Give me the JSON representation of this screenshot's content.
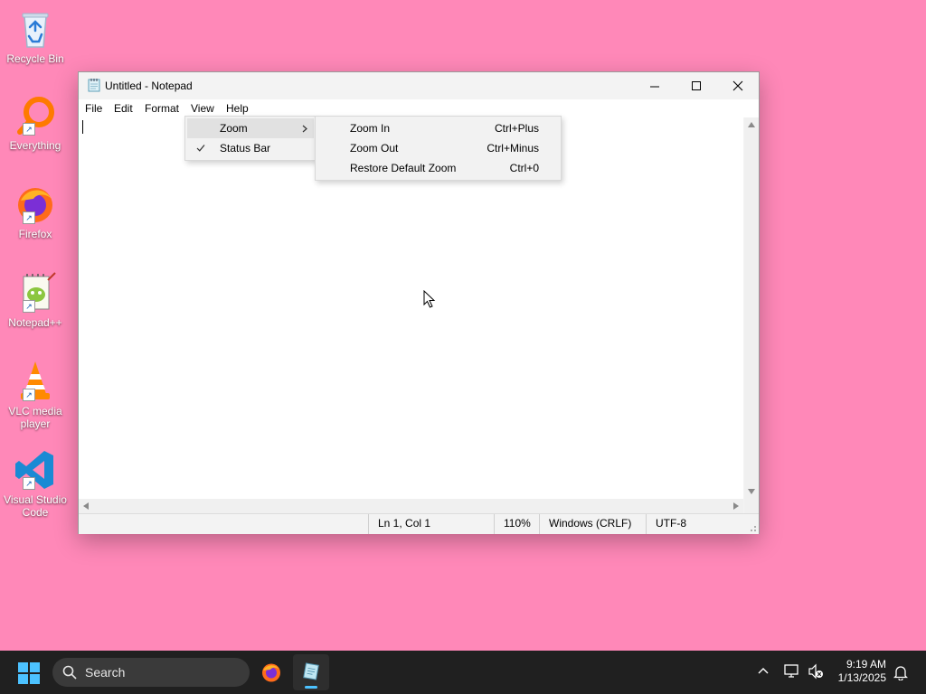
{
  "desktop": {
    "icons": [
      {
        "label": "Recycle Bin"
      },
      {
        "label": "Everything"
      },
      {
        "label": "Firefox"
      },
      {
        "label": "Notepad++"
      },
      {
        "label": "VLC media player"
      },
      {
        "label": "Visual Studio Code"
      }
    ]
  },
  "window": {
    "title": "Untitled - Notepad",
    "menu": [
      "File",
      "Edit",
      "Format",
      "View",
      "Help"
    ],
    "view_menu": {
      "items": [
        {
          "label": "Zoom",
          "has_submenu": true,
          "checked": false
        },
        {
          "label": "Status Bar",
          "has_submenu": false,
          "checked": true
        }
      ]
    },
    "zoom_submenu": {
      "items": [
        {
          "label": "Zoom In",
          "shortcut": "Ctrl+Plus"
        },
        {
          "label": "Zoom Out",
          "shortcut": "Ctrl+Minus"
        },
        {
          "label": "Restore Default Zoom",
          "shortcut": "Ctrl+0"
        }
      ]
    },
    "editor_text": "",
    "status": {
      "position": "Ln 1, Col 1",
      "zoom": "110%",
      "line_endings": "Windows (CRLF)",
      "encoding": "UTF-8"
    }
  },
  "taskbar": {
    "search_label": "Search",
    "time": "9:19 AM",
    "date": "1/13/2025"
  },
  "colors": {
    "desktop_background": "#ff88b8",
    "taskbar": "#202020",
    "menu_highlight": "#e1e1e1"
  }
}
